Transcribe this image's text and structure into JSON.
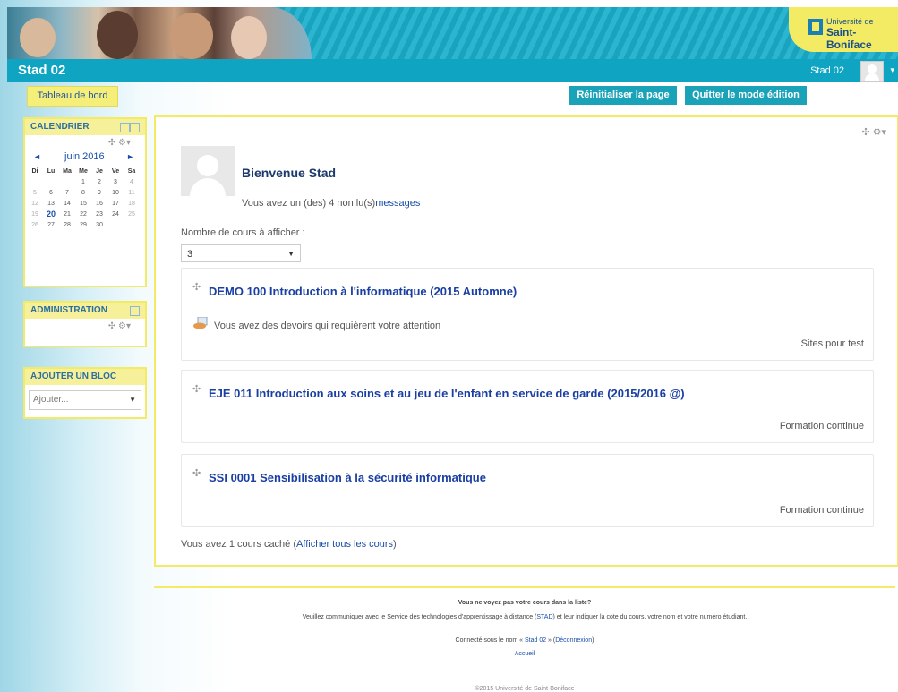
{
  "header": {
    "logo_line1": "Université de",
    "logo_line2": "Saint-Boniface",
    "site_title": "Stad 02",
    "user_name": "Stad 02",
    "caret": "▾"
  },
  "nav": {
    "dashboard": "Tableau de bord",
    "reset_page": "Réinitialiser la page",
    "quit_edit": "Quitter le mode édition"
  },
  "calendar": {
    "title": "CALENDRIER",
    "tools": "✣ ⚙▾",
    "month": "juin 2016",
    "prev": "◄",
    "next": "►",
    "weekdays": [
      "Di",
      "Lu",
      "Ma",
      "Me",
      "Je",
      "Ve",
      "Sa"
    ],
    "weeks": [
      [
        "",
        "",
        "",
        "1",
        "2",
        "3",
        "4"
      ],
      [
        "5",
        "6",
        "7",
        "8",
        "9",
        "10",
        "11"
      ],
      [
        "12",
        "13",
        "14",
        "15",
        "16",
        "17",
        "18"
      ],
      [
        "19",
        "20",
        "21",
        "22",
        "23",
        "24",
        "25"
      ],
      [
        "26",
        "27",
        "28",
        "29",
        "30",
        "",
        ""
      ]
    ],
    "today": "20"
  },
  "administration": {
    "title": "ADMINISTRATION",
    "tools": "✣ ⚙▾"
  },
  "add_block": {
    "title": "AJOUTER UN BLOC",
    "select_value": "Ajouter...",
    "arrow": "▼"
  },
  "main": {
    "tools": "✣ ⚙▾",
    "welcome": "Bienvenue Stad",
    "msg_prefix": "Vous avez un (des) 4 non lu(s)",
    "msg_link": "messages",
    "courses_label": "Nombre de cours à afficher :",
    "courses_count": "3",
    "arrow": "▼",
    "courses": [
      {
        "title": "DEMO 100 Introduction à l'informatique (2015 Automne)",
        "notice": "Vous avez des devoirs qui requièrent votre attention",
        "category": "Sites pour test"
      },
      {
        "title": "EJE 011 Introduction aux soins et au jeu de l'enfant en service de garde (2015/2016 @)",
        "category": "Formation continue"
      },
      {
        "title": "SSI 0001 Sensibilisation à la sécurité informatique",
        "category": "Formation continue"
      }
    ],
    "move_icon": "✣",
    "hidden_prefix": "Vous avez 1 cours caché (",
    "hidden_link": "Afficher tous les cours",
    "hidden_suffix": ")"
  },
  "footer": {
    "question": "Vous ne voyez pas votre cours dans la liste?",
    "text_before": "Veuillez communiquer avec le Service des technologies d'apprentissage à distance (",
    "stad_link": "STAD",
    "text_after": ") et leur indiquer la cote du cours, votre nom et votre numéro étudiant.",
    "logged_prefix": "Connecté sous le nom « ",
    "logged_user": "Stad 02",
    "logged_mid": " » (",
    "logout": "Déconnexion",
    "logged_suffix": ")",
    "home": "Accueil",
    "copyright": "©2015 Université de Saint-Boniface"
  }
}
